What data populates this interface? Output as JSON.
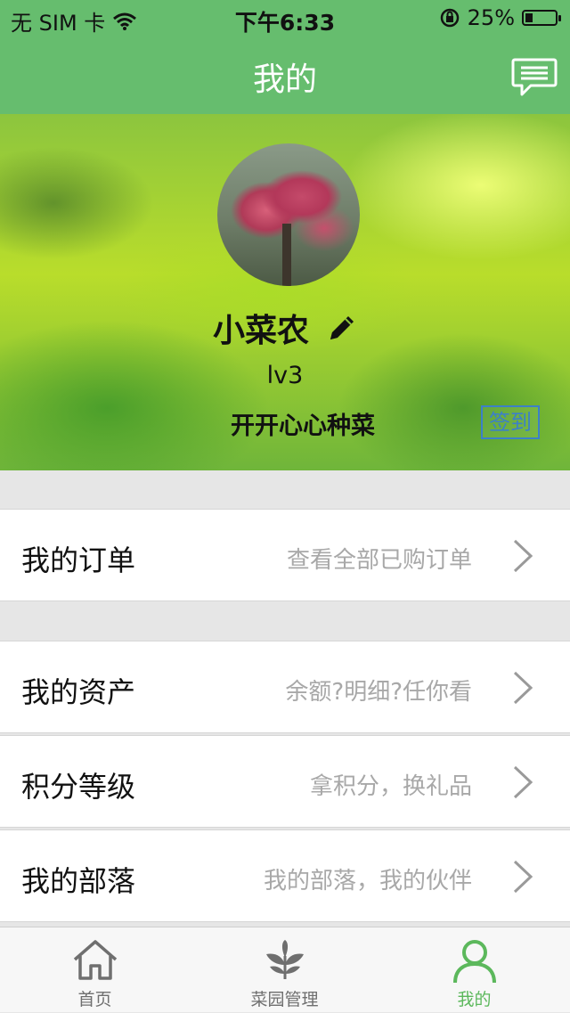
{
  "status_bar": {
    "carrier": "无 SIM 卡",
    "time": "下午6:33",
    "battery": "25%",
    "battery_level": 0.25
  },
  "header": {
    "title": "我的",
    "message_icon": "message-icon"
  },
  "profile": {
    "nickname": "小菜农",
    "level": "lv3",
    "motto": "开开心心种菜",
    "signin_label": "签到"
  },
  "menu": {
    "orders": {
      "label": "我的订单",
      "hint": "查看全部已购订单"
    },
    "assets": {
      "label": "我的资产",
      "hint": "余额?明细?任你看"
    },
    "points": {
      "label": "积分等级",
      "hint": "拿积分，换礼品"
    },
    "tribe": {
      "label": "我的部落",
      "hint": "我的部落，我的伙伴"
    }
  },
  "tabs": [
    {
      "label": "首页",
      "icon": "home-icon"
    },
    {
      "label": "菜园管理",
      "icon": "plant-icon"
    },
    {
      "label": "我的",
      "icon": "user-icon",
      "active": true
    }
  ],
  "colors": {
    "brand_green": "#66bd6e",
    "tab_active": "#5cb85c",
    "signin_blue": "#3c80c8",
    "hint_gray": "#a8a8a8"
  }
}
